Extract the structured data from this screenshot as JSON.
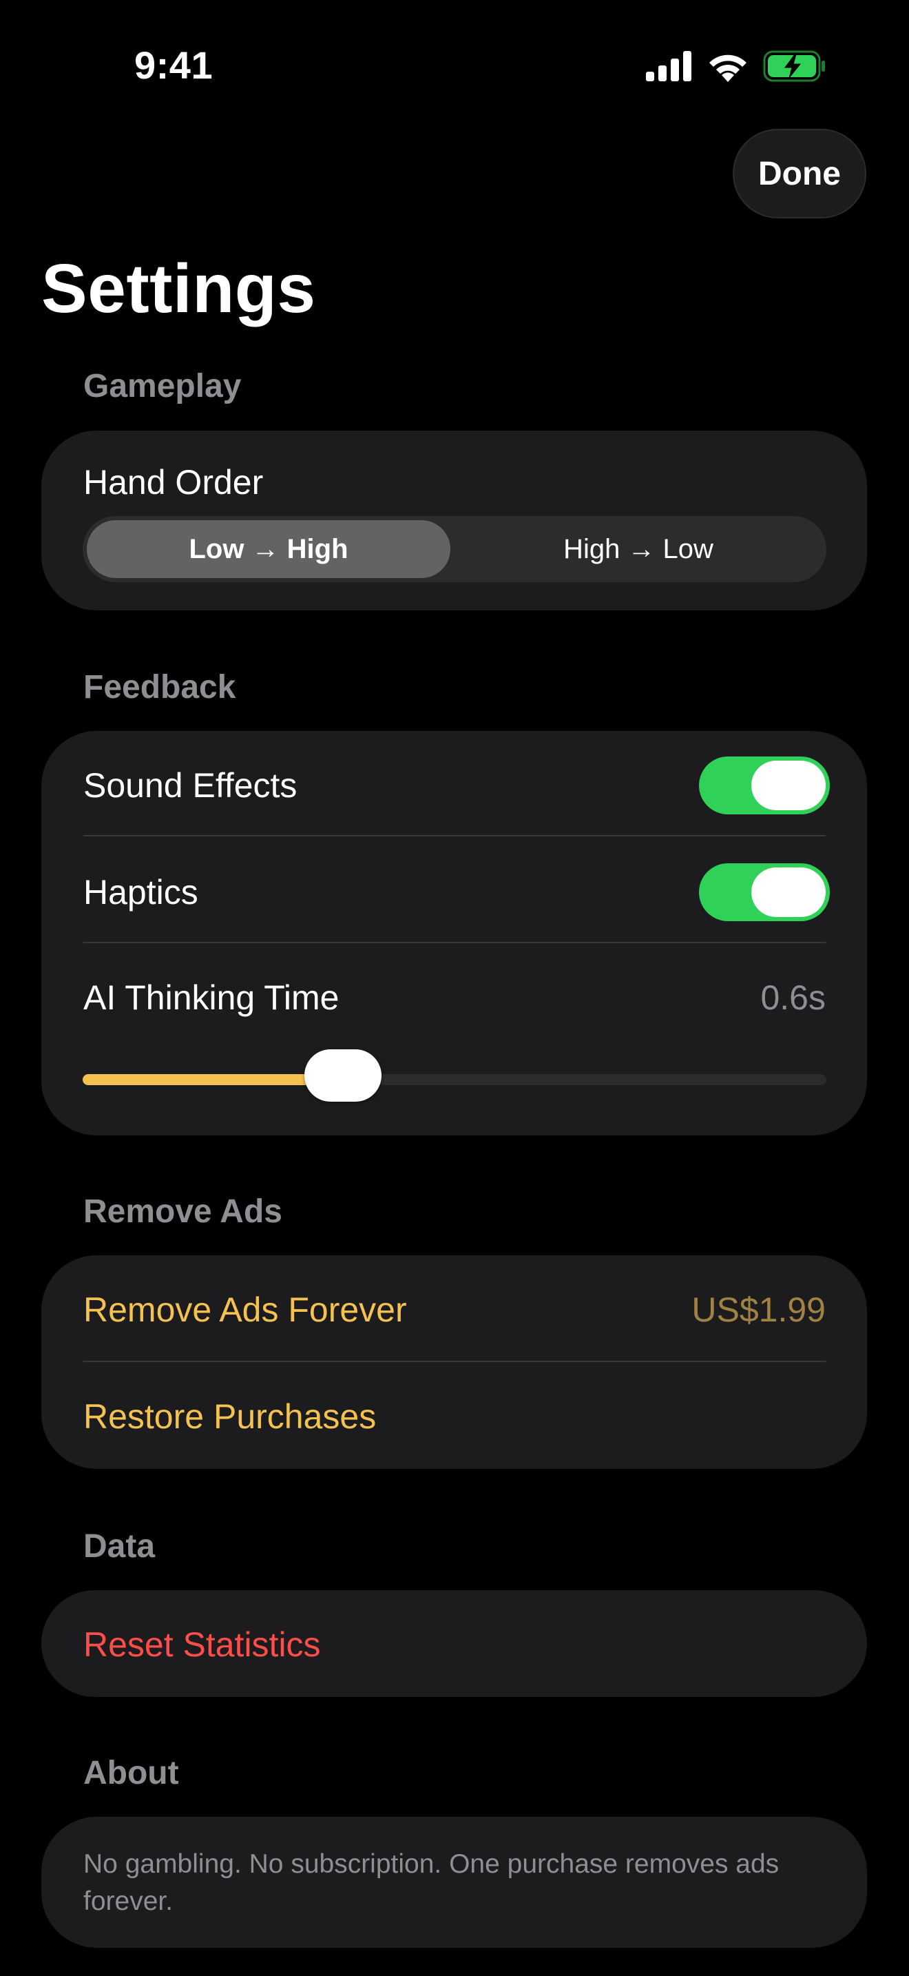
{
  "status_bar": {
    "time": "9:41",
    "icons": [
      "cellular-signal-icon",
      "wifi-icon",
      "battery-charging-icon"
    ],
    "battery_color": "#30d158"
  },
  "header": {
    "done_label": "Done",
    "title": "Settings"
  },
  "gameplay": {
    "header": "Gameplay",
    "hand_order_label": "Hand Order",
    "options": [
      "Low → High",
      "High → Low"
    ],
    "selected": "Low → High"
  },
  "feedback": {
    "header": "Feedback",
    "sound_effects_label": "Sound Effects",
    "sound_effects_on": true,
    "haptics_label": "Haptics",
    "haptics_on": true,
    "ai_thinking_label": "AI Thinking Time",
    "ai_thinking_value": "0.6s",
    "ai_thinking_fraction": 0.35
  },
  "remove_ads": {
    "header": "Remove Ads",
    "remove_forever_label": "Remove Ads Forever",
    "price": "US$1.99",
    "restore_label": "Restore Purchases"
  },
  "data_section": {
    "header": "Data",
    "reset_label": "Reset Statistics"
  },
  "about": {
    "header": "About",
    "text": "No gambling. No subscription. One purchase removes ads forever."
  },
  "colors": {
    "accent_gold": "#f4c24f",
    "toggle_green": "#30d158",
    "destructive_red": "#ff4d4a",
    "card_bg": "#1c1c1e",
    "secondary_text": "#8e8e93"
  }
}
